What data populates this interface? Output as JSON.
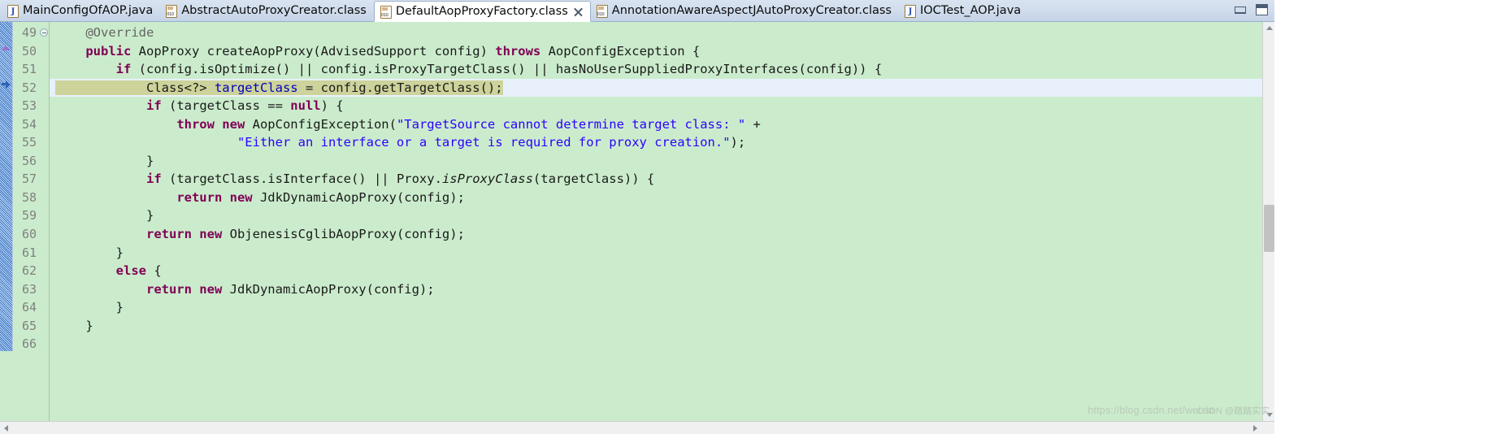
{
  "window": {
    "minimize_label": "Minimize",
    "maximize_label": "Maximize"
  },
  "tabs": [
    {
      "label": "MainConfigOfAOP.java",
      "icon": "java-file-icon",
      "active": false,
      "closable": false
    },
    {
      "label": "AbstractAutoProxyCreator.class",
      "icon": "class-file-icon",
      "active": false,
      "closable": false
    },
    {
      "label": "DefaultAopProxyFactory.class",
      "icon": "class-file-icon",
      "active": true,
      "closable": true
    },
    {
      "label": "AnnotationAwareAspectJAutoProxyCreator.class",
      "icon": "class-file-icon",
      "active": false,
      "closable": false
    },
    {
      "label": "IOCTest_AOP.java",
      "icon": "java-file-icon",
      "active": false,
      "closable": false
    }
  ],
  "editor": {
    "background_color": "#cbeccc",
    "current_line_color": "#e8f1fb",
    "selection_color": "#cdd39a",
    "keyword_color": "#7f0055",
    "string_color": "#2a00ff",
    "annotation_color": "#646464",
    "first_line": 49,
    "last_line": 66,
    "line_numbers": [
      "49",
      "50",
      "51",
      "52",
      "53",
      "54",
      "55",
      "56",
      "57",
      "58",
      "59",
      "60",
      "61",
      "62",
      "63",
      "64",
      "65",
      "66"
    ],
    "fold_marker_line": "49",
    "annotation_markers": [
      {
        "line": "50",
        "type": "overrides-marker-icon"
      },
      {
        "line": "52",
        "type": "debug-current-instruction-icon"
      }
    ],
    "lines": [
      {
        "num": "49",
        "text": "    @Override"
      },
      {
        "num": "50",
        "text": "    public AopProxy createAopProxy(AdvisedSupport config) throws AopConfigException {"
      },
      {
        "num": "51",
        "text": "        if (config.isOptimize() || config.isProxyTargetClass() || hasNoUserSuppliedProxyInterfaces(config)) {"
      },
      {
        "num": "52",
        "text": "            Class<?> targetClass = config.getTargetClass();"
      },
      {
        "num": "53",
        "text": "            if (targetClass == null) {"
      },
      {
        "num": "54",
        "text": "                throw new AopConfigException(\"TargetSource cannot determine target class: \" +"
      },
      {
        "num": "55",
        "text": "                        \"Either an interface or a target is required for proxy creation.\");"
      },
      {
        "num": "56",
        "text": "            }"
      },
      {
        "num": "57",
        "text": "            if (targetClass.isInterface() || Proxy.isProxyClass(targetClass)) {"
      },
      {
        "num": "58",
        "text": "                return new JdkDynamicAopProxy(config);"
      },
      {
        "num": "59",
        "text": "            }"
      },
      {
        "num": "60",
        "text": "            return new ObjenesisCglibAopProxy(config);"
      },
      {
        "num": "61",
        "text": "        }"
      },
      {
        "num": "62",
        "text": "        else {"
      },
      {
        "num": "63",
        "text": "            return new JdkDynamicAopProxy(config);"
      },
      {
        "num": "64",
        "text": "        }"
      },
      {
        "num": "65",
        "text": "    }"
      },
      {
        "num": "66",
        "text": ""
      }
    ],
    "selected_line": "52",
    "selected_text": "Class<?> targetClass = config.getTargetClass();"
  },
  "watermark": {
    "url": "https://blog.csdn.net/weixin",
    "brand": "CSDN @踏踏实实"
  }
}
